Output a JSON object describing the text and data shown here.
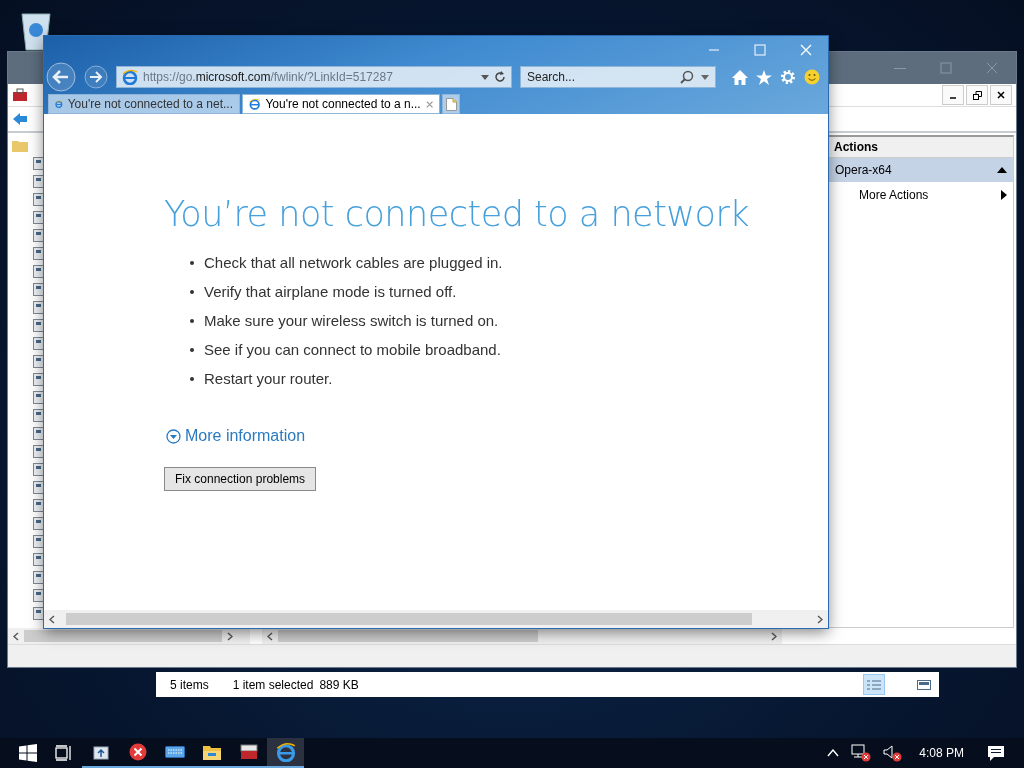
{
  "mmc_window": {
    "actions": {
      "title": "Actions",
      "group": {
        "label": "Opera-x64",
        "expanded": true
      },
      "items": [
        {
          "label": "More Actions"
        }
      ]
    }
  },
  "browser": {
    "address": "https://go.**microsoft.com**/fwlink/?LinkId=517287",
    "search_placeholder": "Search...",
    "tabs": [
      {
        "title": "You're not connected to a net...",
        "selected": false
      },
      {
        "title": "You're not connected to a n...",
        "selected": true
      }
    ],
    "page": {
      "heading": "You’re not connected to a network",
      "bullets": [
        "Check that all network cables are plugged in.",
        "Verify that airplane mode is turned off.",
        "Make sure your wireless switch is turned on.",
        "See if you can connect to mobile broadband.",
        "Restart your router."
      ],
      "more_link": "More information",
      "fix_button": "Fix connection problems"
    }
  },
  "explorer_status": {
    "item_count": "5 items",
    "selection": "1 item selected",
    "size": "889 KB",
    "views": [
      {
        "kind": "details",
        "selected": true
      },
      {
        "kind": "tiles",
        "selected": false
      }
    ]
  },
  "taskbar": {
    "apps": [
      {
        "kind": "server",
        "active": false
      },
      {
        "kind": "error",
        "active": false
      },
      {
        "kind": "keyboard",
        "active": false
      },
      {
        "kind": "folder",
        "active": false
      },
      {
        "kind": "toolbox",
        "active": false
      },
      {
        "kind": "browser",
        "active": true
      }
    ],
    "clock": "4:08 PM"
  }
}
